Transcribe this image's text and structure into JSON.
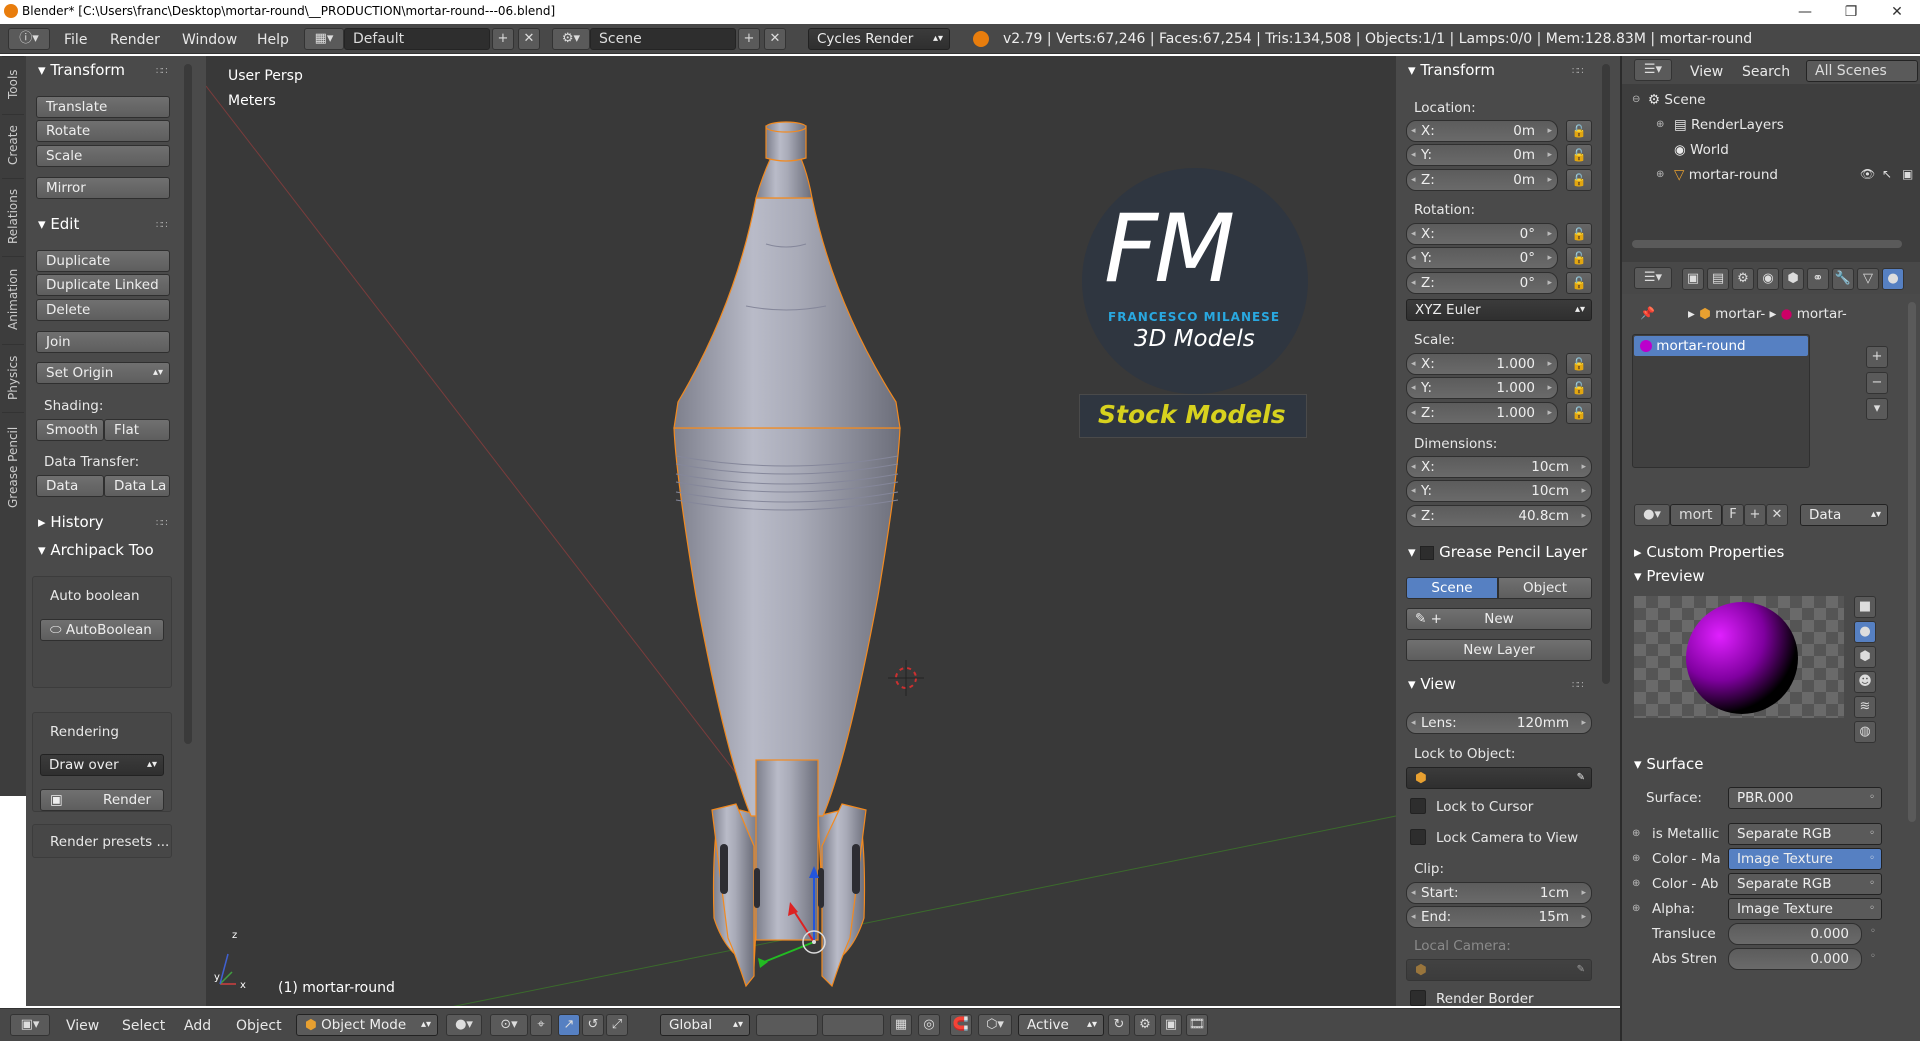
{
  "window": {
    "title": "Blender* [C:\\Users\\franc\\Desktop\\mortar-round\\__PRODUCTION\\mortar-round---06.blend]",
    "minimize": "—",
    "maximize": "❐",
    "close": "✕"
  },
  "menu": {
    "file": "File",
    "render": "Render",
    "window": "Window",
    "help": "Help"
  },
  "screen_layout": "Default",
  "scene_field": "Scene",
  "engine": "Cycles Render",
  "stats": "v2.79 | Verts:67,246 | Faces:67,254 | Tris:134,508 | Objects:1/1 | Lamps:0/0 | Mem:128.83M | mortar-round",
  "tool_tabs": [
    "Tools",
    "Create",
    "Relations",
    "Animation",
    "Physics",
    "Grease Pencil"
  ],
  "toolshelf": {
    "transform_header": "Transform",
    "translate": "Translate",
    "rotate": "Rotate",
    "scale": "Scale",
    "mirror": "Mirror",
    "edit_header": "Edit",
    "duplicate": "Duplicate",
    "duplicate_linked": "Duplicate Linked",
    "delete": "Delete",
    "join": "Join",
    "set_origin": "Set Origin",
    "shading_label": "Shading:",
    "smooth": "Smooth",
    "flat": "Flat",
    "data_transfer_label": "Data Transfer:",
    "data": "Data",
    "data_la": "Data La",
    "history_header": "History",
    "archipack_header": "Archipack Too",
    "auto_boolean_label": "Auto boolean",
    "autoboolean_button": "AutoBoolean",
    "rendering_label": "Rendering",
    "draw_over": "Draw over",
    "render_button": "Render",
    "render_presets": "Render presets ..."
  },
  "viewport": {
    "view_name": "User Persp",
    "units": "Meters",
    "object_label": "(1) mortar-round",
    "axis_x": "x",
    "axis_y": "y",
    "axis_z": "z",
    "logo": {
      "letters": "FM",
      "name": "FRANCESCO MILANESE",
      "sub": "3D Models",
      "stock": "Stock Models"
    }
  },
  "npanel": {
    "transform_header": "Transform",
    "location_label": "Location:",
    "location": [
      {
        "axis": "X:",
        "value": "0m"
      },
      {
        "axis": "Y:",
        "value": "0m"
      },
      {
        "axis": "Z:",
        "value": "0m"
      }
    ],
    "rotation_label": "Rotation:",
    "rotation": [
      {
        "axis": "X:",
        "value": "0°"
      },
      {
        "axis": "Y:",
        "value": "0°"
      },
      {
        "axis": "Z:",
        "value": "0°"
      }
    ],
    "rotation_mode": "XYZ Euler",
    "scale_label": "Scale:",
    "scale": [
      {
        "axis": "X:",
        "value": "1.000"
      },
      {
        "axis": "Y:",
        "value": "1.000"
      },
      {
        "axis": "Z:",
        "value": "1.000"
      }
    ],
    "dimensions_label": "Dimensions:",
    "dimensions": [
      {
        "axis": "X:",
        "value": "10cm"
      },
      {
        "axis": "Y:",
        "value": "10cm"
      },
      {
        "axis": "Z:",
        "value": "40.8cm"
      }
    ],
    "grease_header": "Grease Pencil Layer",
    "scene_tab": "Scene",
    "object_tab": "Object",
    "new": "New",
    "new_layer": "New Layer",
    "view_header": "View",
    "lens_label": "Lens:",
    "lens": "120mm",
    "lock_object_label": "Lock to Object:",
    "lock_cursor": "Lock to Cursor",
    "lock_camera": "Lock Camera to View",
    "clip_label": "Clip:",
    "clip_start_label": "Start:",
    "clip_start": "1cm",
    "clip_end_label": "End:",
    "clip_end": "15m",
    "local_camera": "Local Camera:",
    "render_border": "Render Border"
  },
  "outliner": {
    "view": "View",
    "search": "Search",
    "all_scenes": "All Scenes",
    "tree": [
      "Scene",
      "RenderLayers",
      "World",
      "mortar-round"
    ]
  },
  "properties": {
    "crumb1": "mortar-",
    "crumb2": "mortar-",
    "material_slot": "mortar-round",
    "mat_name": "mort",
    "f_label": "F",
    "data_dropdown": "Data",
    "custom_props": "Custom Properties",
    "preview": "Preview",
    "surface_header": "Surface",
    "surface_label": "Surface:",
    "surface_value": "PBR.000",
    "rows": [
      {
        "label": "is Metallic",
        "value": "Separate RGB"
      },
      {
        "label": "Color - Ma",
        "value": "Image Texture"
      },
      {
        "label": "Color - Ab",
        "value": "Separate RGB"
      },
      {
        "label": "Alpha:",
        "value": "Image Texture"
      }
    ],
    "translucency_label": "Transluce",
    "translucency": "0.000",
    "abs_label": "Abs Stren",
    "abs": "0.000"
  },
  "bottom": {
    "view": "View",
    "select": "Select",
    "add": "Add",
    "object": "Object",
    "mode": "Object Mode",
    "orientation": "Global",
    "pivot": "Active"
  },
  "colors": {
    "accent": "#5680c2",
    "object_outline": "#f28a20",
    "logo_blue": "#29a8e0",
    "stock_yellow": "#d7d11e"
  }
}
